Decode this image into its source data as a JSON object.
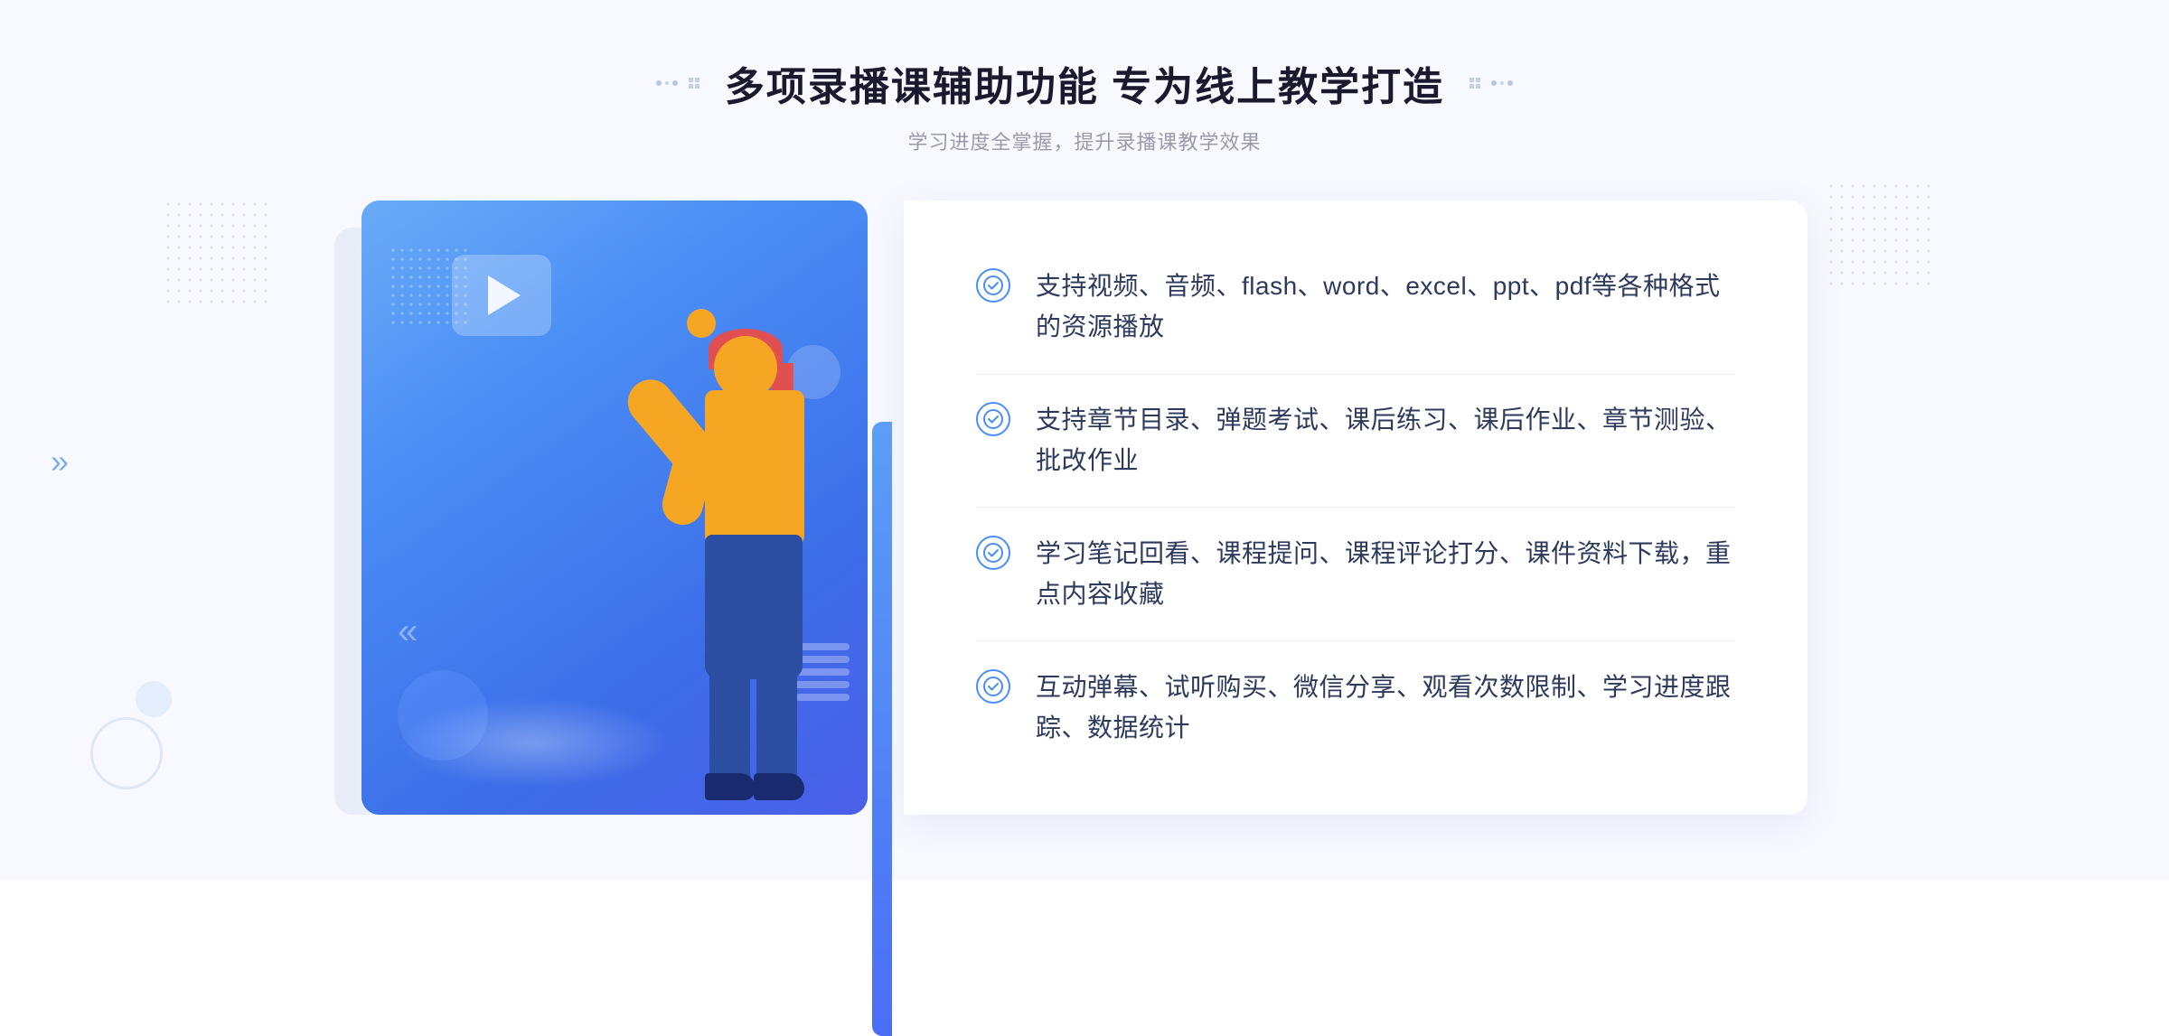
{
  "page": {
    "background_color": "#f5f7ff"
  },
  "header": {
    "title": "多项录播课辅助功能 专为线上教学打造",
    "subtitle": "学习进度全掌握，提升录播课教学效果",
    "deco_left": "❖",
    "deco_right": "❖"
  },
  "features": [
    {
      "id": 1,
      "text": "支持视频、音频、flash、word、excel、ppt、pdf等各种格式的资源播放"
    },
    {
      "id": 2,
      "text": "支持章节目录、弹题考试、课后练习、课后作业、章节测验、批改作业"
    },
    {
      "id": 3,
      "text": "学习笔记回看、课程提问、课程评论打分、课件资料下载，重点内容收藏"
    },
    {
      "id": 4,
      "text": "互动弹幕、试听购买、微信分享、观看次数限制、学习进度跟踪、数据统计"
    }
  ],
  "icons": {
    "check": "✓",
    "chevron_left": "»",
    "play": "▶"
  },
  "colors": {
    "primary_blue": "#4a8ef5",
    "dark_blue": "#2c4fa3",
    "text_dark": "#2d3a5c",
    "text_gray": "#999aaa",
    "bg_light": "#f5f7ff"
  }
}
